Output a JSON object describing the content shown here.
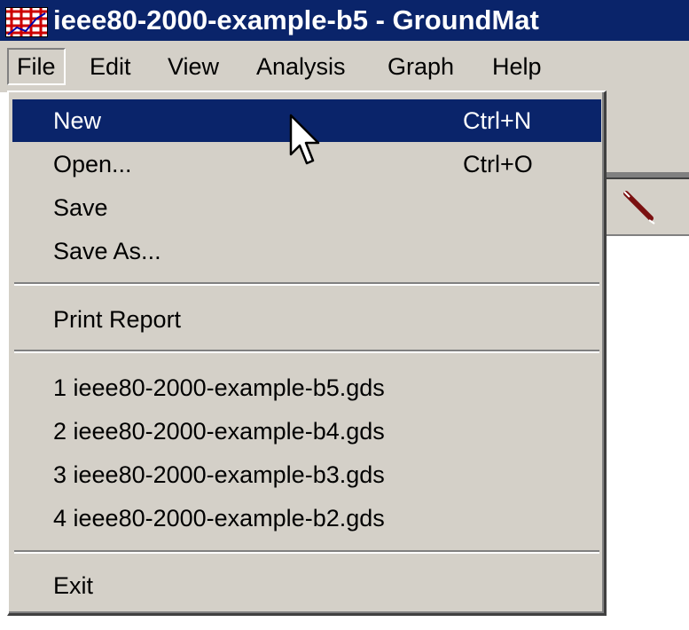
{
  "window": {
    "title": "ieee80-2000-example-b5  -  GroundMat",
    "icon": "grid-app-icon"
  },
  "menubar": {
    "items": [
      {
        "label": "File",
        "active": true
      },
      {
        "label": "Edit"
      },
      {
        "label": "View"
      },
      {
        "label": "Analysis"
      },
      {
        "label": "Graph"
      },
      {
        "label": "Help"
      }
    ]
  },
  "file_menu": {
    "new": {
      "label": "New",
      "shortcut": "Ctrl+N"
    },
    "open": {
      "label": "Open...",
      "shortcut": "Ctrl+O"
    },
    "save": {
      "label": "Save"
    },
    "save_as": {
      "label": "Save As..."
    },
    "print_report": {
      "label": "Print Report"
    },
    "recent": [
      "1 ieee80-2000-example-b5.gds",
      "2 ieee80-2000-example-b4.gds",
      "3 ieee80-2000-example-b3.gds",
      "4 ieee80-2000-example-b2.gds"
    ],
    "exit": {
      "label": "Exit"
    }
  },
  "colors": {
    "titlebar": "#0a246a",
    "highlight": "#0a246a",
    "face": "#d4d0c8",
    "app_icon_grid": "#cc0000"
  },
  "icons": {
    "cursor": "mouse-pointer-icon",
    "toolbar_tool": "pencil-line-icon"
  }
}
